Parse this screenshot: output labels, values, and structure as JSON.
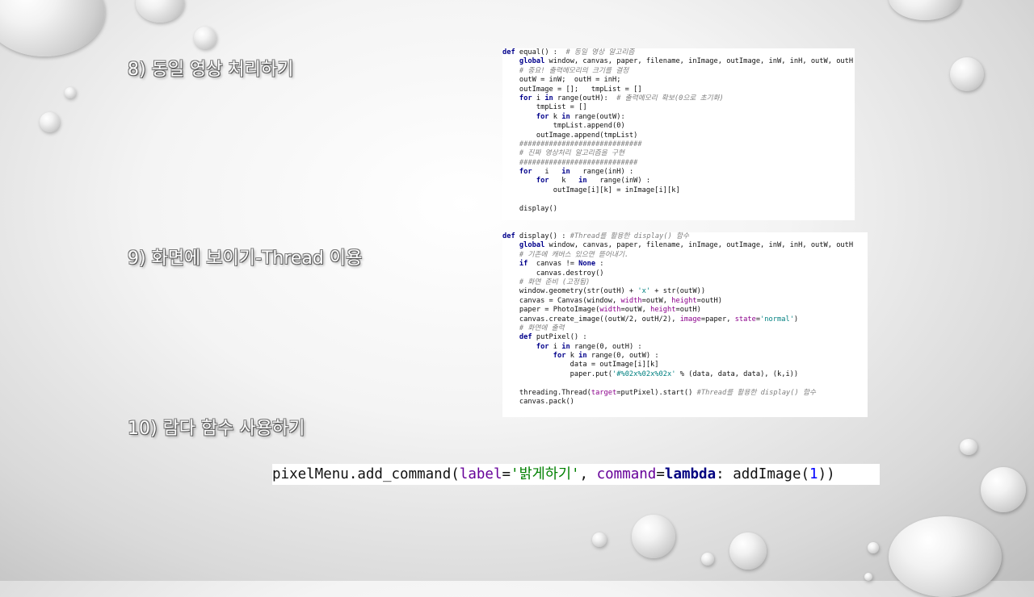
{
  "headings": {
    "h8": "8) 동일 영상 처리하기",
    "h9": "9) 화면에 보이기-Thread 이용",
    "h10": "10) 람다 함수 사용하기"
  },
  "code_equal": [
    [
      [
        "def",
        "kw"
      ],
      [
        " equal() :  ",
        ""
      ],
      [
        "# 동일 영상 알고리즘",
        "cm"
      ]
    ],
    [
      [
        "    global",
        "kw"
      ],
      [
        " window, canvas, paper, filename, inImage, outImage, inW, inH, outW, outH",
        ""
      ]
    ],
    [
      [
        "    # 중요! 출력메모리의 크기를 결정",
        "cm"
      ]
    ],
    [
      [
        "    outW = inW;  outH = inH;",
        ""
      ]
    ],
    [
      [
        "    outImage = [];   tmpList = []",
        ""
      ]
    ],
    [
      [
        "    for",
        "kw"
      ],
      [
        " i ",
        ""
      ],
      [
        "in",
        "kw"
      ],
      [
        " range(outH):  ",
        ""
      ],
      [
        "# 출력메모리 확보(0으로 초기화)",
        "cm"
      ]
    ],
    [
      [
        "        tmpList = []",
        ""
      ]
    ],
    [
      [
        "        for",
        "kw"
      ],
      [
        " k ",
        ""
      ],
      [
        "in",
        "kw"
      ],
      [
        " range(outW):",
        ""
      ]
    ],
    [
      [
        "            tmpList.append(0)",
        ""
      ]
    ],
    [
      [
        "        outImage.append(tmpList)",
        ""
      ]
    ],
    [
      [
        "    #############################",
        "cm"
      ]
    ],
    [
      [
        "    # 진짜 영상처리 알고리즘을 구현",
        "cm"
      ]
    ],
    [
      [
        "    ############################",
        "cm"
      ]
    ],
    [
      [
        "    for",
        "kw"
      ],
      [
        "   i   ",
        ""
      ],
      [
        "in",
        "kw"
      ],
      [
        "   range(inH) :",
        ""
      ]
    ],
    [
      [
        "        for",
        "kw"
      ],
      [
        "   k   ",
        ""
      ],
      [
        "in",
        "kw"
      ],
      [
        "   range(inW) :",
        ""
      ]
    ],
    [
      [
        "            outImage[i][k] = inImage[i][k]",
        ""
      ]
    ],
    [
      [
        "",
        ""
      ]
    ],
    [
      [
        "    display()",
        ""
      ]
    ]
  ],
  "code_display": [
    [
      [
        "def",
        "kw"
      ],
      [
        " display() : ",
        ""
      ],
      [
        "#Thread를 활용한 display() 함수",
        "cm"
      ]
    ],
    [
      [
        "    global",
        "kw"
      ],
      [
        " window, canvas, paper, filename, inImage, outImage, inW, inH, outW, outH",
        ""
      ]
    ],
    [
      [
        "    # 기존에 캐버스 있으면 뜯어내기.",
        "cm"
      ]
    ],
    [
      [
        "    if",
        "kw"
      ],
      [
        "  canvas != ",
        ""
      ],
      [
        "None",
        "kw"
      ],
      [
        " :",
        ""
      ]
    ],
    [
      [
        "        canvas.destroy()",
        ""
      ]
    ],
    [
      [
        "    # 화면 준비 (고정됨)",
        "cm"
      ]
    ],
    [
      [
        "    window.geometry(str(outH) + ",
        ""
      ],
      [
        "'x'",
        "st"
      ],
      [
        " + str(outW))",
        ""
      ]
    ],
    [
      [
        "    canvas = Canvas(window, ",
        ""
      ],
      [
        "width",
        "kwarg"
      ],
      [
        "=outW, ",
        ""
      ],
      [
        "height",
        "kwarg"
      ],
      [
        "=outH)",
        ""
      ]
    ],
    [
      [
        "    paper = PhotoImage(",
        ""
      ],
      [
        "width",
        "kwarg"
      ],
      [
        "=outW, ",
        ""
      ],
      [
        "height",
        "kwarg"
      ],
      [
        "=outH)",
        ""
      ]
    ],
    [
      [
        "    canvas.create_image((outW/2, outH/2), ",
        ""
      ],
      [
        "image",
        "kwarg"
      ],
      [
        "=paper, ",
        ""
      ],
      [
        "state",
        "kwarg"
      ],
      [
        "=",
        ""
      ],
      [
        "'normal'",
        "st"
      ],
      [
        ")",
        ""
      ]
    ],
    [
      [
        "    # 화면에 출력",
        "cm"
      ]
    ],
    [
      [
        "    def",
        "kw"
      ],
      [
        " putPixel() :",
        ""
      ]
    ],
    [
      [
        "        for",
        "kw"
      ],
      [
        " i ",
        ""
      ],
      [
        "in",
        "kw"
      ],
      [
        " range(0, outH) :",
        ""
      ]
    ],
    [
      [
        "            for",
        "kw"
      ],
      [
        " k ",
        ""
      ],
      [
        "in",
        "kw"
      ],
      [
        " range(0, outW) :",
        ""
      ]
    ],
    [
      [
        "                data = outImage[i][k]",
        ""
      ]
    ],
    [
      [
        "                paper.put(",
        ""
      ],
      [
        "'#%02x%02x%02x'",
        "st"
      ],
      [
        " % (data, data, data), (k,i))",
        ""
      ]
    ],
    [
      [
        "",
        ""
      ]
    ],
    [
      [
        "    threading.Thread(",
        ""
      ],
      [
        "target",
        "kwarg"
      ],
      [
        "=putPixel).start() ",
        ""
      ],
      [
        "#Thread를 활용한 display() 함수",
        "cm"
      ]
    ],
    [
      [
        "    canvas.pack()",
        ""
      ]
    ]
  ],
  "command_line": [
    [
      "pixelMenu.add_command(",
      ""
    ],
    [
      "label",
      "kwarg"
    ],
    [
      "=",
      ""
    ],
    [
      "'밝게하기'",
      "st"
    ],
    [
      ", ",
      ""
    ],
    [
      "command",
      "kwarg"
    ],
    [
      "=",
      ""
    ],
    [
      "lambda",
      "kw"
    ],
    [
      ": addImage(",
      ""
    ],
    [
      "1",
      "num"
    ],
    [
      "))",
      ""
    ]
  ]
}
